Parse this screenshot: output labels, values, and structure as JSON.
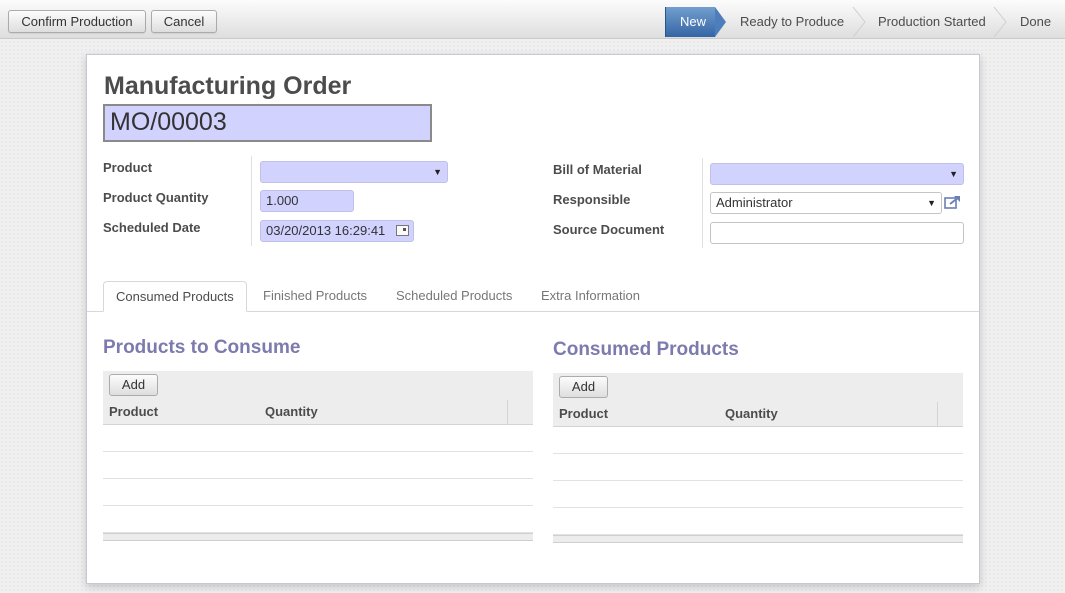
{
  "header": {
    "buttons": {
      "confirm": "Confirm Production",
      "cancel": "Cancel"
    },
    "stages": [
      {
        "label": "New",
        "active": true
      },
      {
        "label": "Ready to Produce",
        "active": false
      },
      {
        "label": "Production Started",
        "active": false
      },
      {
        "label": "Done",
        "active": false
      }
    ]
  },
  "form": {
    "model_label": "Manufacturing Order",
    "reference": "MO/00003",
    "left": {
      "product": {
        "label": "Product",
        "value": ""
      },
      "product_qty": {
        "label": "Product Quantity",
        "value": "1.000"
      },
      "scheduled_date": {
        "label": "Scheduled Date",
        "value": "03/20/2013 16:29:41"
      }
    },
    "right": {
      "bom": {
        "label": "Bill of Material",
        "value": ""
      },
      "responsible": {
        "label": "Responsible",
        "value": "Administrator"
      },
      "source_document": {
        "label": "Source Document",
        "value": ""
      }
    }
  },
  "tabs": [
    {
      "label": "Consumed Products",
      "active": true
    },
    {
      "label": "Finished Products",
      "active": false
    },
    {
      "label": "Scheduled Products",
      "active": false
    },
    {
      "label": "Extra Information",
      "active": false
    }
  ],
  "panels": {
    "to_consume": {
      "title": "Products to Consume",
      "add_label": "Add",
      "columns": [
        "Product",
        "Quantity"
      ]
    },
    "consumed": {
      "title": "Consumed Products",
      "add_label": "Add",
      "columns": [
        "Product",
        "Quantity"
      ]
    }
  },
  "colors": {
    "accent": "#3465a4",
    "required_field": "#d2d2ff",
    "section_title": "#7c7bad"
  },
  "icons": {
    "calendar": "calendar-icon",
    "open_record": "external-link-icon",
    "dropdown": "caret-down-icon"
  }
}
